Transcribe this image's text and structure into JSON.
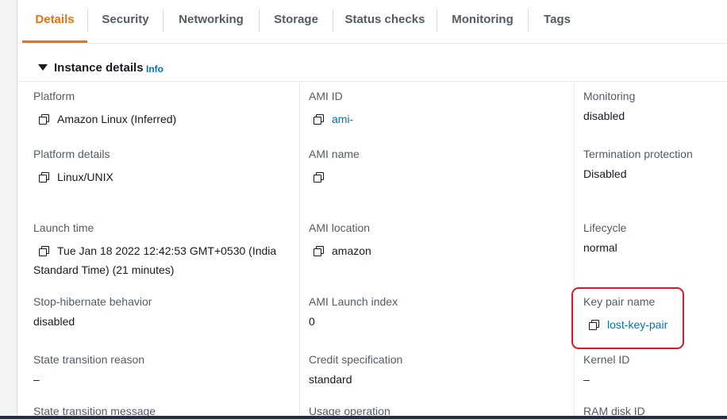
{
  "tabs": [
    {
      "label": "Details",
      "active": true
    },
    {
      "label": "Security"
    },
    {
      "label": "Networking"
    },
    {
      "label": "Storage"
    },
    {
      "label": "Status checks"
    },
    {
      "label": "Monitoring"
    },
    {
      "label": "Tags"
    }
  ],
  "section": {
    "title": "Instance details",
    "info": "Info"
  },
  "fields": {
    "platform": {
      "label": "Platform",
      "value": "Amazon Linux (Inferred)"
    },
    "platform_details": {
      "label": "Platform details",
      "value": "Linux/UNIX"
    },
    "launch_time": {
      "label": "Launch time",
      "value": "Tue Jan 18 2022 12:42:53 GMT+0530 (India Standard Time) (21 minutes)"
    },
    "stop_hibernate": {
      "label": "Stop-hibernate behavior",
      "value": "disabled"
    },
    "state_transition_reason": {
      "label": "State transition reason",
      "value": "–"
    },
    "state_transition_message": {
      "label": "State transition message"
    },
    "ami_id": {
      "label": "AMI ID",
      "value": "ami-"
    },
    "ami_name": {
      "label": "AMI name",
      "value": ""
    },
    "ami_location": {
      "label": "AMI location",
      "value": "amazon"
    },
    "ami_launch_index": {
      "label": "AMI Launch index",
      "value": "0"
    },
    "credit_specification": {
      "label": "Credit specification",
      "value": "standard"
    },
    "usage_operation": {
      "label": "Usage operation"
    },
    "monitoring": {
      "label": "Monitoring",
      "value": "disabled"
    },
    "termination_protection": {
      "label": "Termination protection",
      "value": "Disabled"
    },
    "lifecycle": {
      "label": "Lifecycle",
      "value": "normal"
    },
    "key_pair_name": {
      "label": "Key pair name",
      "value": "lost-key-pair"
    },
    "kernel_id": {
      "label": "Kernel ID",
      "value": "–"
    },
    "ram_disk_id": {
      "label": "RAM disk ID"
    }
  },
  "colors": {
    "accent": "#ec7211",
    "link": "#0073bb",
    "highlight": "#d61a2a"
  }
}
